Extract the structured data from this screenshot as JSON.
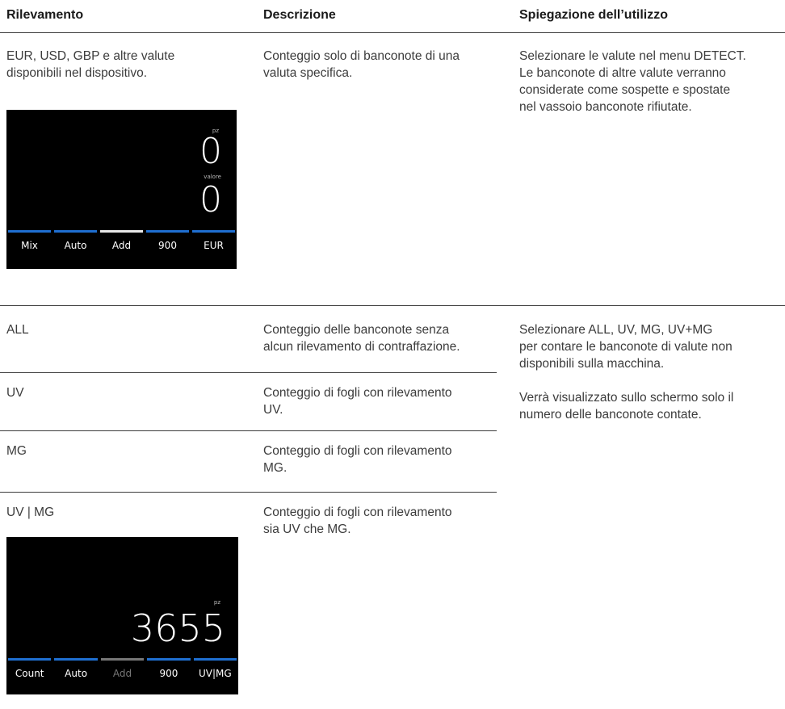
{
  "headers": {
    "col1": "Rilevamento",
    "col2": "Descrizione",
    "col3": "Spiegazione dell’utilizzo"
  },
  "section1": {
    "col1_lines": [
      "EUR, USD, GBP e altre valute",
      "disponibili nel dispositivo."
    ],
    "col2_lines": [
      "Conteggio solo di banconote di una",
      "valuta specifica."
    ],
    "col3_lines": [
      "Selezionare le valute nel menu DETECT.",
      "Le banconote di altre valute verranno",
      "considerate come sospette e spostate",
      "nel vassoio banconote rifiutate."
    ],
    "screen": {
      "pcs_label": "pz",
      "pcs_value": "0",
      "value_label": "valore",
      "value_value": "0",
      "tabs": [
        {
          "label": "Mix",
          "bar_color": "#1f6fd1",
          "label_color": "#ffffff"
        },
        {
          "label": "Auto",
          "bar_color": "#1f6fd1",
          "label_color": "#ffffff"
        },
        {
          "label": "Add",
          "bar_color": "#e8e8e8",
          "label_color": "#ffffff"
        },
        {
          "label": "900",
          "bar_color": "#1f6fd1",
          "label_color": "#ffffff"
        },
        {
          "label": "EUR",
          "bar_color": "#1f6fd1",
          "label_color": "#ffffff"
        }
      ]
    }
  },
  "section2": {
    "rows": [
      {
        "mode": "ALL",
        "desc_lines": [
          "Conteggio delle banconote senza",
          "alcun rilevamento di contraffazione."
        ]
      },
      {
        "mode": "UV",
        "desc_lines": [
          "Conteggio di fogli con rilevamento",
          "UV."
        ]
      },
      {
        "mode": "MG",
        "desc_lines": [
          "Conteggio di fogli con rilevamento",
          "MG."
        ]
      },
      {
        "mode": "UV | MG",
        "desc_lines": [
          "Conteggio di fogli con rilevamento",
          "sia UV che MG."
        ]
      }
    ],
    "col3_para1": [
      "Selezionare ALL, UV, MG,  UV+MG",
      "per contare le banconote di valute non",
      "disponibili sulla macchina."
    ],
    "col3_para2": [
      "Verrà visualizzato sullo schermo solo il",
      "numero delle banconote contate."
    ],
    "screen": {
      "pcs_label": "pz",
      "pcs_value": "3655",
      "tabs": [
        {
          "label": "Count",
          "bar_color": "#1f6fd1",
          "label_color": "#ffffff"
        },
        {
          "label": "Auto",
          "bar_color": "#1f6fd1",
          "label_color": "#ffffff"
        },
        {
          "label": "Add",
          "bar_color": "#777777",
          "label_color": "#777777"
        },
        {
          "label": "900",
          "bar_color": "#1f6fd1",
          "label_color": "#ffffff"
        },
        {
          "label": "UV|MG",
          "bar_color": "#1f6fd1",
          "label_color": "#ffffff"
        }
      ]
    }
  }
}
